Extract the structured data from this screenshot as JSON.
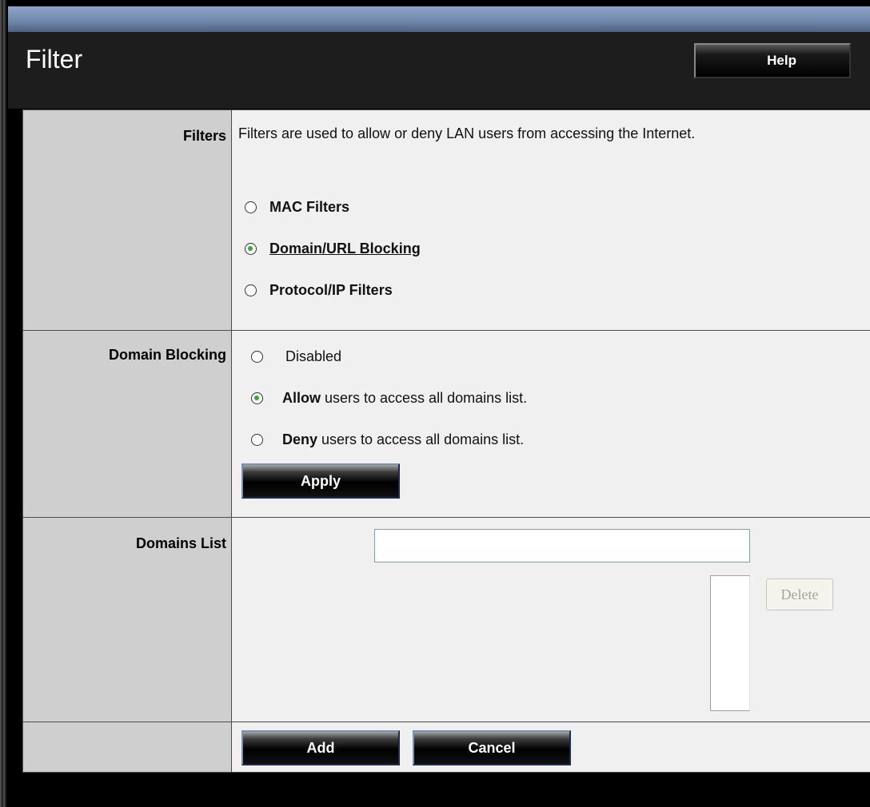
{
  "header": {
    "title": "Filter",
    "help_label": "Help"
  },
  "filters": {
    "label": "Filters",
    "description": "Filters are used to allow or deny LAN users from accessing the Internet.",
    "options": [
      {
        "label": "MAC Filters",
        "selected": false
      },
      {
        "label": "Domain/URL Blocking",
        "selected": true
      },
      {
        "label": "Protocol/IP Filters",
        "selected": false
      }
    ]
  },
  "domain_blocking": {
    "label": "Domain Blocking",
    "disabled_label": "Disabled",
    "allow_bold": "Allow",
    "allow_rest": " users to access all domains list.",
    "deny_bold": "Deny",
    "deny_rest": " users to access all domains list.",
    "selected": "allow",
    "apply_label": "Apply"
  },
  "domains_list": {
    "label": "Domains List",
    "input_value": "",
    "delete_label": "Delete"
  },
  "footer": {
    "add_label": "Add",
    "cancel_label": "Cancel"
  },
  "colors": {
    "radio_dot": "#2fae2f",
    "label_bg": "#cfcfcf",
    "content_bg": "#f0f0f0",
    "header_bg": "#1d1d1d"
  }
}
